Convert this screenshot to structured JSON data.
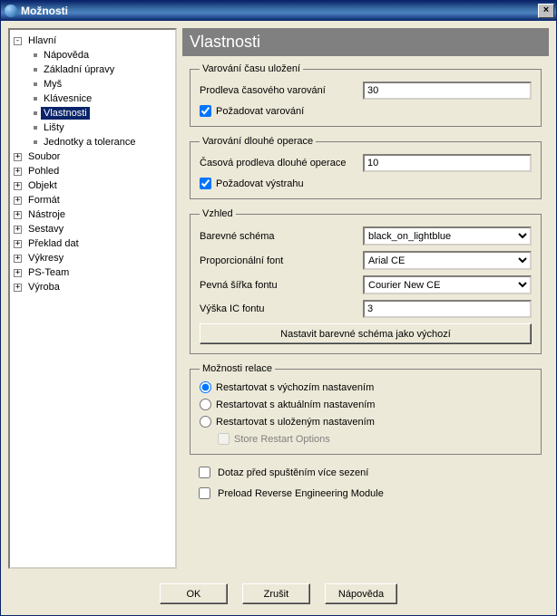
{
  "window": {
    "title": "Možnosti"
  },
  "tree": {
    "root": "Hlavní",
    "children": [
      "Nápověda",
      "Základní úpravy",
      "Myš",
      "Klávesnice",
      "Vlastnosti",
      "Lišty",
      "Jednotky a tolerance"
    ],
    "selected_index": 4,
    "top_level": [
      "Soubor",
      "Pohled",
      "Objekt",
      "Formát",
      "Nástroje",
      "Sestavy",
      "Překlad dat",
      "Výkresy",
      "PS-Team",
      "Výroba"
    ]
  },
  "page": {
    "title": "Vlastnosti"
  },
  "group_save": {
    "legend": "Varování času uložení",
    "delay_label": "Prodleva časového varování",
    "delay_value": "30",
    "require_label": "Požadovat varování",
    "require_checked": true
  },
  "group_long": {
    "legend": "Varování dlouhé operace",
    "delay_label": "Časová prodleva dlouhé operace",
    "delay_value": "10",
    "require_label": "Požadovat výstrahu",
    "require_checked": true
  },
  "group_look": {
    "legend": "Vzhled",
    "scheme_label": "Barevné schéma",
    "scheme_value": "black_on_lightblue",
    "pfont_label": "Proporcionální font",
    "pfont_value": "Arial CE",
    "ffont_label": "Pevná šířka fontu",
    "ffont_value": "Courier New CE",
    "icfont_label": "Výška IC fontu",
    "icfont_value": "3",
    "reset_button": "Nastavit barevné schéma jako výchozí"
  },
  "group_session": {
    "legend": "Možnosti relace",
    "r0": "Restartovat s výchozím nastavením",
    "r1": "Restartovat s aktuálním nastavením",
    "r2": "Restartovat s uloženým nastavením",
    "selected": 0,
    "store_label": "Store Restart Options",
    "store_enabled": false
  },
  "outer_checks": {
    "ask_label": "Dotaz před spuštěním více sezení",
    "ask_checked": false,
    "preload_label": "Preload Reverse Engineering Module",
    "preload_checked": false
  },
  "buttons": {
    "ok": "OK",
    "cancel": "Zrušit",
    "help": "Nápověda"
  }
}
